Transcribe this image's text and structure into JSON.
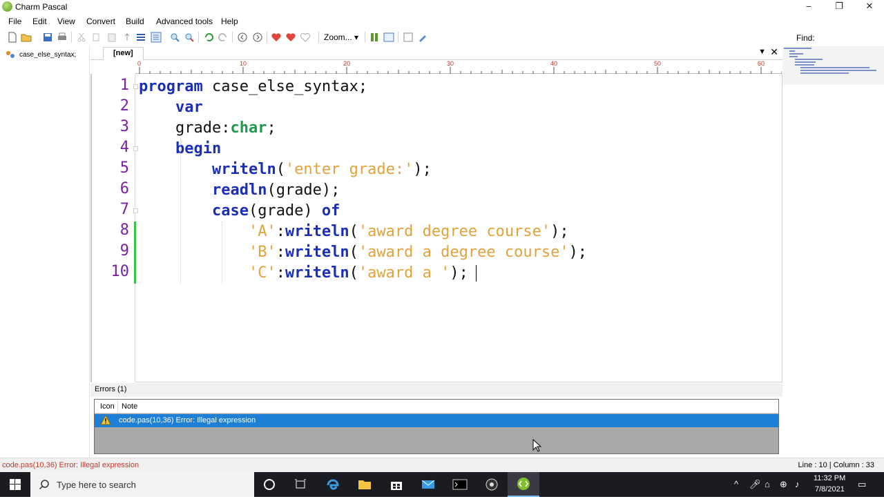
{
  "window": {
    "title": "Charm Pascal",
    "minimize": "–",
    "restore": "❐",
    "close": "✕"
  },
  "menu": [
    "File",
    "Edit",
    "View",
    "Convert",
    "Build",
    "Advanced tools",
    "Help"
  ],
  "toolbar": {
    "zoom_label": "Zoom...",
    "find_label": "Find:",
    "find_value": ""
  },
  "file_tree": {
    "item": "case_else_syntax;"
  },
  "tabs": [
    {
      "label": "[new]"
    }
  ],
  "ruler": {
    "labels": [
      "0",
      "10",
      "20",
      "30",
      "40",
      "50",
      "60"
    ]
  },
  "editor": {
    "line_numbers": [
      "1",
      "2",
      "3",
      "4",
      "5",
      "6",
      "7",
      "8",
      "9",
      "10"
    ],
    "lines": [
      [
        {
          "t": "kw",
          "v": "program"
        },
        {
          "t": "pl",
          "v": " case_else_syntax;"
        }
      ],
      [
        {
          "t": "pl",
          "v": "    "
        },
        {
          "t": "kw",
          "v": "var"
        }
      ],
      [
        {
          "t": "pl",
          "v": "    grade:"
        },
        {
          "t": "ty",
          "v": "char"
        },
        {
          "t": "pl",
          "v": ";"
        }
      ],
      [
        {
          "t": "pl",
          "v": "    "
        },
        {
          "t": "kw",
          "v": "begin"
        }
      ],
      [
        {
          "t": "pl",
          "v": "        "
        },
        {
          "t": "kw",
          "v": "writeln"
        },
        {
          "t": "pl",
          "v": "("
        },
        {
          "t": "st",
          "v": "'enter grade:'"
        },
        {
          "t": "pl",
          "v": ");"
        }
      ],
      [
        {
          "t": "pl",
          "v": "        "
        },
        {
          "t": "kw",
          "v": "readln"
        },
        {
          "t": "pl",
          "v": "(grade);"
        }
      ],
      [
        {
          "t": "pl",
          "v": "        "
        },
        {
          "t": "kw",
          "v": "case"
        },
        {
          "t": "pl",
          "v": "(grade) "
        },
        {
          "t": "kw",
          "v": "of"
        }
      ],
      [
        {
          "t": "pl",
          "v": "            "
        },
        {
          "t": "st",
          "v": "'A'"
        },
        {
          "t": "pl",
          "v": ":"
        },
        {
          "t": "kw",
          "v": "writeln"
        },
        {
          "t": "pl",
          "v": "("
        },
        {
          "t": "st",
          "v": "'award degree course'"
        },
        {
          "t": "pl",
          "v": ");"
        }
      ],
      [
        {
          "t": "pl",
          "v": "            "
        },
        {
          "t": "st",
          "v": "'B'"
        },
        {
          "t": "pl",
          "v": ":"
        },
        {
          "t": "kw",
          "v": "writeln"
        },
        {
          "t": "pl",
          "v": "("
        },
        {
          "t": "st",
          "v": "'award a degree course'"
        },
        {
          "t": "pl",
          "v": ");"
        }
      ],
      [
        {
          "t": "pl",
          "v": "            "
        },
        {
          "t": "st",
          "v": "'C'"
        },
        {
          "t": "pl",
          "v": ":"
        },
        {
          "t": "kw",
          "v": "writeln"
        },
        {
          "t": "pl",
          "v": "("
        },
        {
          "t": "st",
          "v": "'award a '"
        },
        {
          "t": "pl",
          "v": ");"
        }
      ]
    ]
  },
  "errors": {
    "title": "Errors (1)",
    "columns": [
      "Icon",
      "Note"
    ],
    "rows": [
      {
        "note": "code.pas(10,36) Error: Illegal expression"
      }
    ]
  },
  "status": {
    "error": "code.pas(10,36) Error: Illegal expression",
    "position": "Line : 10 | Column : 33"
  },
  "taskbar": {
    "search_placeholder": "Type here to search",
    "time": "11:32 PM",
    "date": "7/8/2021"
  },
  "colors": {
    "keyword": "#1a2fb5",
    "type": "#1e9a4a",
    "string": "#e2a23a",
    "line_number": "#7a1fa2",
    "selection": "#1e7fd6",
    "taskbar": "#1b1b22"
  }
}
